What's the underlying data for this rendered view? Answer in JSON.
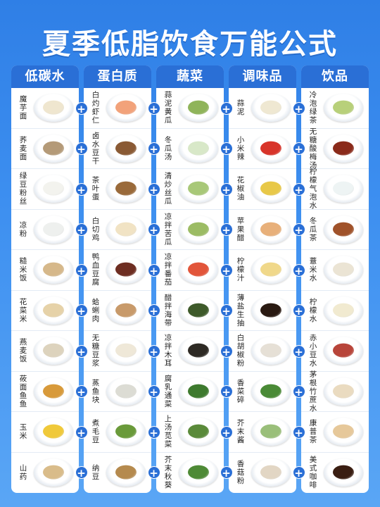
{
  "title": "夏季低脂饮食万能公式",
  "plus_symbol": "+",
  "columns": [
    {
      "header": "低碳水",
      "items": [
        {
          "label": "魔芋面",
          "color": "#efe6cf"
        },
        {
          "label": "荞麦面",
          "color": "#b49a78"
        },
        {
          "label": "绿豆粉丝",
          "color": "#f3f3ee"
        },
        {
          "label": "凉粉",
          "color": "#eef0ee"
        },
        {
          "label": "糙米饭",
          "color": "#d6b88a"
        },
        {
          "label": "花菜米",
          "color": "#e6d2a8"
        },
        {
          "label": "燕麦饭",
          "color": "#ddd3bd"
        },
        {
          "label": "莜面鱼鱼",
          "color": "#d89a3a"
        },
        {
          "label": "玉米",
          "color": "#f0c93a"
        },
        {
          "label": "山药",
          "color": "#d9bc8a"
        }
      ]
    },
    {
      "header": "蛋白质",
      "items": [
        {
          "label": "白灼虾仁",
          "color": "#f2a27a"
        },
        {
          "label": "卤水豆干",
          "color": "#8a5a34"
        },
        {
          "label": "茶叶蛋",
          "color": "#9a6a3a"
        },
        {
          "label": "白切鸡",
          "color": "#f1e3c4"
        },
        {
          "label": "鸭血豆腐",
          "color": "#6e2e22"
        },
        {
          "label": "蛤蜊肉",
          "color": "#c89a6a"
        },
        {
          "label": "无糖豆浆",
          "color": "#efe8d8"
        },
        {
          "label": "蒸鱼块",
          "color": "#dcdcd4"
        },
        {
          "label": "煮毛豆",
          "color": "#6a9a3a"
        },
        {
          "label": "纳豆",
          "color": "#b58a4e"
        }
      ]
    },
    {
      "header": "蔬菜",
      "items": [
        {
          "label": "蒜泥黄瓜",
          "color": "#8fb45a"
        },
        {
          "label": "冬瓜汤",
          "color": "#d8e8c8"
        },
        {
          "label": "清炒丝瓜",
          "color": "#a8c878"
        },
        {
          "label": "凉拌苦瓜",
          "color": "#9cbc64"
        },
        {
          "label": "凉拌番茄",
          "color": "#e2553a"
        },
        {
          "label": "醋拌海带",
          "color": "#3e5a2a"
        },
        {
          "label": "凉拌木耳",
          "color": "#2e2a24"
        },
        {
          "label": "腐乳通菜",
          "color": "#3e7a2e"
        },
        {
          "label": "上汤苋菜",
          "color": "#5a8a3a"
        },
        {
          "label": "芥末秋葵",
          "color": "#4e8a36"
        }
      ]
    },
    {
      "header": "调味品",
      "items": [
        {
          "label": "蒜泥",
          "color": "#efe8d2"
        },
        {
          "label": "小米辣",
          "color": "#d8342a"
        },
        {
          "label": "花椒油",
          "color": "#e8c848"
        },
        {
          "label": "苹果醋",
          "color": "#e8b07a"
        },
        {
          "label": "柠檬汁",
          "color": "#f0d88a"
        },
        {
          "label": "薄盐生抽",
          "color": "#2a1a12"
        },
        {
          "label": "白胡椒粉",
          "color": "#e6e0d6"
        },
        {
          "label": "香菜碎",
          "color": "#4a8a36"
        },
        {
          "label": "芥末酱",
          "color": "#9abf7a"
        },
        {
          "label": "香菇粉",
          "color": "#e2d6c4"
        }
      ]
    },
    {
      "header": "饮品",
      "items": [
        {
          "label": "冷泡绿茶",
          "color": "#b8d07a"
        },
        {
          "label": "无糖酸梅汤",
          "color": "#8a2a1a"
        },
        {
          "label": "柠檬气泡水",
          "color": "#eef4f4"
        },
        {
          "label": "冬瓜茶",
          "color": "#a0522a"
        },
        {
          "label": "薏米水",
          "color": "#ebe4d4"
        },
        {
          "label": "柠檬水",
          "color": "#f1ead0"
        },
        {
          "label": "赤小豆水",
          "color": "#b8453a"
        },
        {
          "label": "茅根竹蔗水",
          "color": "#eadbc0"
        },
        {
          "label": "康普茶",
          "color": "#e6c89a"
        },
        {
          "label": "美式咖啡",
          "color": "#3a1e12"
        }
      ]
    }
  ]
}
